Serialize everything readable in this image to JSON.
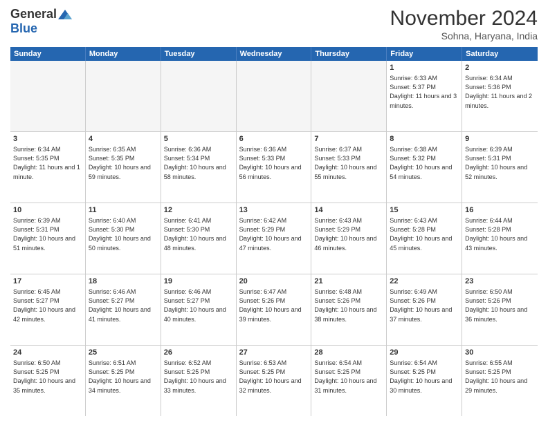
{
  "header": {
    "logo_general": "General",
    "logo_blue": "Blue",
    "month_title": "November 2024",
    "location": "Sohna, Haryana, India"
  },
  "calendar": {
    "days_of_week": [
      "Sunday",
      "Monday",
      "Tuesday",
      "Wednesday",
      "Thursday",
      "Friday",
      "Saturday"
    ],
    "weeks": [
      {
        "cells": [
          {
            "day": "",
            "empty": true
          },
          {
            "day": "",
            "empty": true
          },
          {
            "day": "",
            "empty": true
          },
          {
            "day": "",
            "empty": true
          },
          {
            "day": "",
            "empty": true
          },
          {
            "day": "1",
            "sunrise": "6:33 AM",
            "sunset": "5:37 PM",
            "daylight": "11 hours and 3 minutes."
          },
          {
            "day": "2",
            "sunrise": "6:34 AM",
            "sunset": "5:36 PM",
            "daylight": "11 hours and 2 minutes."
          }
        ]
      },
      {
        "cells": [
          {
            "day": "3",
            "sunrise": "6:34 AM",
            "sunset": "5:35 PM",
            "daylight": "11 hours and 1 minute."
          },
          {
            "day": "4",
            "sunrise": "6:35 AM",
            "sunset": "5:35 PM",
            "daylight": "10 hours and 59 minutes."
          },
          {
            "day": "5",
            "sunrise": "6:36 AM",
            "sunset": "5:34 PM",
            "daylight": "10 hours and 58 minutes."
          },
          {
            "day": "6",
            "sunrise": "6:36 AM",
            "sunset": "5:33 PM",
            "daylight": "10 hours and 56 minutes."
          },
          {
            "day": "7",
            "sunrise": "6:37 AM",
            "sunset": "5:33 PM",
            "daylight": "10 hours and 55 minutes."
          },
          {
            "day": "8",
            "sunrise": "6:38 AM",
            "sunset": "5:32 PM",
            "daylight": "10 hours and 54 minutes."
          },
          {
            "day": "9",
            "sunrise": "6:39 AM",
            "sunset": "5:31 PM",
            "daylight": "10 hours and 52 minutes."
          }
        ]
      },
      {
        "cells": [
          {
            "day": "10",
            "sunrise": "6:39 AM",
            "sunset": "5:31 PM",
            "daylight": "10 hours and 51 minutes."
          },
          {
            "day": "11",
            "sunrise": "6:40 AM",
            "sunset": "5:30 PM",
            "daylight": "10 hours and 50 minutes."
          },
          {
            "day": "12",
            "sunrise": "6:41 AM",
            "sunset": "5:30 PM",
            "daylight": "10 hours and 48 minutes."
          },
          {
            "day": "13",
            "sunrise": "6:42 AM",
            "sunset": "5:29 PM",
            "daylight": "10 hours and 47 minutes."
          },
          {
            "day": "14",
            "sunrise": "6:43 AM",
            "sunset": "5:29 PM",
            "daylight": "10 hours and 46 minutes."
          },
          {
            "day": "15",
            "sunrise": "6:43 AM",
            "sunset": "5:28 PM",
            "daylight": "10 hours and 45 minutes."
          },
          {
            "day": "16",
            "sunrise": "6:44 AM",
            "sunset": "5:28 PM",
            "daylight": "10 hours and 43 minutes."
          }
        ]
      },
      {
        "cells": [
          {
            "day": "17",
            "sunrise": "6:45 AM",
            "sunset": "5:27 PM",
            "daylight": "10 hours and 42 minutes."
          },
          {
            "day": "18",
            "sunrise": "6:46 AM",
            "sunset": "5:27 PM",
            "daylight": "10 hours and 41 minutes."
          },
          {
            "day": "19",
            "sunrise": "6:46 AM",
            "sunset": "5:27 PM",
            "daylight": "10 hours and 40 minutes."
          },
          {
            "day": "20",
            "sunrise": "6:47 AM",
            "sunset": "5:26 PM",
            "daylight": "10 hours and 39 minutes."
          },
          {
            "day": "21",
            "sunrise": "6:48 AM",
            "sunset": "5:26 PM",
            "daylight": "10 hours and 38 minutes."
          },
          {
            "day": "22",
            "sunrise": "6:49 AM",
            "sunset": "5:26 PM",
            "daylight": "10 hours and 37 minutes."
          },
          {
            "day": "23",
            "sunrise": "6:50 AM",
            "sunset": "5:26 PM",
            "daylight": "10 hours and 36 minutes."
          }
        ]
      },
      {
        "cells": [
          {
            "day": "24",
            "sunrise": "6:50 AM",
            "sunset": "5:25 PM",
            "daylight": "10 hours and 35 minutes."
          },
          {
            "day": "25",
            "sunrise": "6:51 AM",
            "sunset": "5:25 PM",
            "daylight": "10 hours and 34 minutes."
          },
          {
            "day": "26",
            "sunrise": "6:52 AM",
            "sunset": "5:25 PM",
            "daylight": "10 hours and 33 minutes."
          },
          {
            "day": "27",
            "sunrise": "6:53 AM",
            "sunset": "5:25 PM",
            "daylight": "10 hours and 32 minutes."
          },
          {
            "day": "28",
            "sunrise": "6:54 AM",
            "sunset": "5:25 PM",
            "daylight": "10 hours and 31 minutes."
          },
          {
            "day": "29",
            "sunrise": "6:54 AM",
            "sunset": "5:25 PM",
            "daylight": "10 hours and 30 minutes."
          },
          {
            "day": "30",
            "sunrise": "6:55 AM",
            "sunset": "5:25 PM",
            "daylight": "10 hours and 29 minutes."
          }
        ]
      }
    ]
  }
}
